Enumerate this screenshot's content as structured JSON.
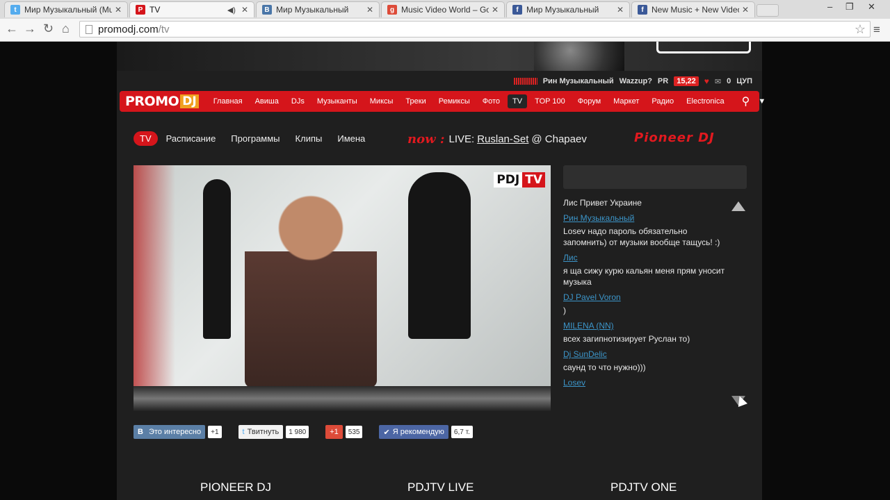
{
  "browser": {
    "tabs": [
      {
        "title": "Мир Музыкальный (Mus",
        "fav": "twitter-icon",
        "color": "#55acee"
      },
      {
        "title": "TV",
        "fav": "promodj-icon",
        "color": "#d5151b",
        "active": true
      },
      {
        "title": "Мир Музыкальный",
        "fav": "vk-icon",
        "color": "#4a76a8"
      },
      {
        "title": "Music Video World – Goo",
        "fav": "google-plus-icon",
        "color": "#dd4b39"
      },
      {
        "title": "Мир Музыкальный",
        "fav": "facebook-icon",
        "color": "#3b5998"
      },
      {
        "title": "New Music + New Video",
        "fav": "facebook-icon",
        "color": "#3b5998"
      }
    ],
    "url_host": "promodj.com",
    "url_path": "/tv"
  },
  "topbar": {
    "user": "Рин Музыкальный",
    "wazzup": "Wazzup?",
    "pr_label": "PR",
    "pr_value": "15,22",
    "mail_count": "0",
    "cup_label": "ЦУП"
  },
  "nav": {
    "logo_promo": "PROMO",
    "logo_dj": "DJ",
    "items": [
      "Главная",
      "Авиша",
      "DJs",
      "Музыканты",
      "Миксы",
      "Треки",
      "Ремиксы",
      "Фото",
      "TV",
      "TOP 100",
      "Форум",
      "Маркет",
      "Радио",
      "Electronica"
    ]
  },
  "subnav": {
    "tv": "TV",
    "items": [
      "Расписание",
      "Программы",
      "Клипы",
      "Имена"
    ]
  },
  "now": {
    "label": "now :",
    "live": "LIVE:",
    "artist": "Ruslan-Set",
    "venue": "@ Chapaev"
  },
  "sponsor": "Pioneer DJ",
  "video": {
    "badge_p": "PDJ",
    "badge_t": "TV"
  },
  "chat": {
    "messages": [
      {
        "user": "",
        "text": "Лис Привет Украине"
      },
      {
        "user": "Рин Музыкальный",
        "text": "Losev надо пароль обязательно запомнить) от музыки вообще тащусь! :)"
      },
      {
        "user": "Лис",
        "text": "я ща сижу курю кальян меня прям уносит музыка"
      },
      {
        "user": "DJ Pavel Voron",
        "text": ")"
      },
      {
        "user": "MILENA (NN)",
        "text": "всех загипнотизирует Руслан то)"
      },
      {
        "user": "Dj SunDelic",
        "text": "саунд то что нужно)))"
      },
      {
        "user": "Losev",
        "text": ""
      }
    ]
  },
  "social": {
    "vk_label": "Это интересно",
    "vk_count": "+1",
    "tw_label": "Твитнуть",
    "tw_count": "1 980",
    "gp_label": "+1",
    "gp_count": "535",
    "fb_label": "Я рекомендую",
    "fb_count": "6,7 т."
  },
  "channels": [
    "PIONEER DJ",
    "PDJTV LIVE",
    "PDJTV ONE"
  ]
}
